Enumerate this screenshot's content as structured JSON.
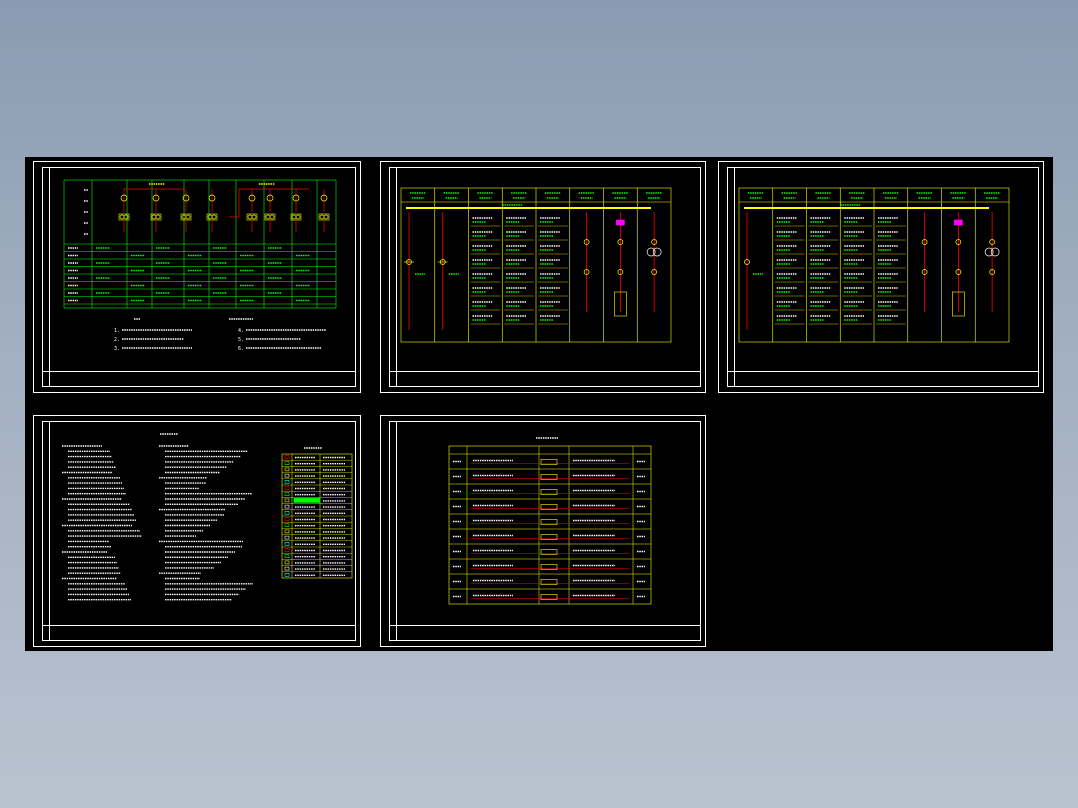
{
  "viewer": {
    "background_color": "#8a9bb1",
    "model_space_color": "#000000"
  },
  "colors": {
    "frame": "#ffffff",
    "table": "#00ff00",
    "bus": "#ffff00",
    "wire": "#ff0000",
    "highlight": "#ff00ff",
    "device": "#00ffff"
  },
  "sheets": [
    {
      "id": "sheet-1",
      "content": "switchgear-scheme-with-notes",
      "notes": [
        "7.",
        "1.",
        "2.",
        "3.",
        "4.",
        "5.",
        "6."
      ]
    },
    {
      "id": "sheet-2",
      "content": "distribution-single-line-diagram"
    },
    {
      "id": "sheet-3",
      "content": "distribution-single-line-diagram"
    },
    {
      "id": "sheet-4",
      "content": "design-notes-and-legend"
    },
    {
      "id": "sheet-5",
      "content": "cable-schedule-table",
      "rows": 10
    }
  ]
}
